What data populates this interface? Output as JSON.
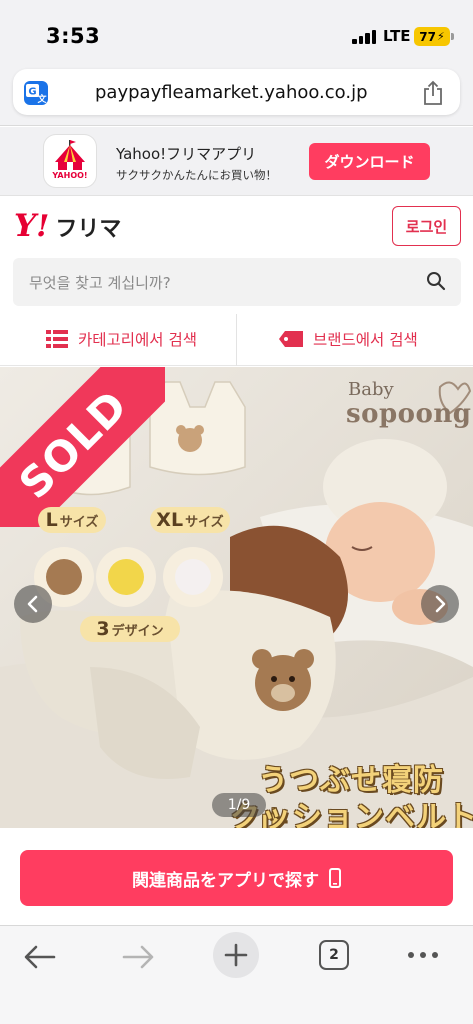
{
  "status_bar": {
    "time": "3:53",
    "network": "LTE",
    "battery": "77"
  },
  "browser": {
    "url": "paypayfleamarket.yahoo.co.jp",
    "tab_count": "2"
  },
  "app_banner": {
    "title": "Yahoo!フリマアプリ",
    "subtitle": "サクサクかんたんにお買い物！",
    "download_label": "ダウンロード",
    "icon_caption": "YAHOO!"
  },
  "header": {
    "logo_y": "Y",
    "logo_ex": "!",
    "logo_text": "フリマ",
    "login_label": "로그인"
  },
  "search": {
    "placeholder": "무엇을 찾고 계십니까?"
  },
  "nav": {
    "category_label": "카테고리에서 검색",
    "brand_label": "브랜드에서 검색"
  },
  "product": {
    "sold_label": "SOLD",
    "brand_small": "Baby",
    "brand_big": "sopoong",
    "size_chips": [
      {
        "big": "L",
        "small": "サイズ"
      },
      {
        "big": "XL",
        "small": "サイズ"
      }
    ],
    "design_chip": {
      "big": "3",
      "small": "デザイン"
    },
    "caption_line1": "うつぶせ寝防止",
    "caption_line2": "クッションベルト",
    "image_counter": "1/9"
  },
  "cta": {
    "label": "関連商品をアプリで探す"
  },
  "colors": {
    "accent": "#ff3d60",
    "brand_red": "#e60033",
    "link_red": "#e2304f"
  }
}
